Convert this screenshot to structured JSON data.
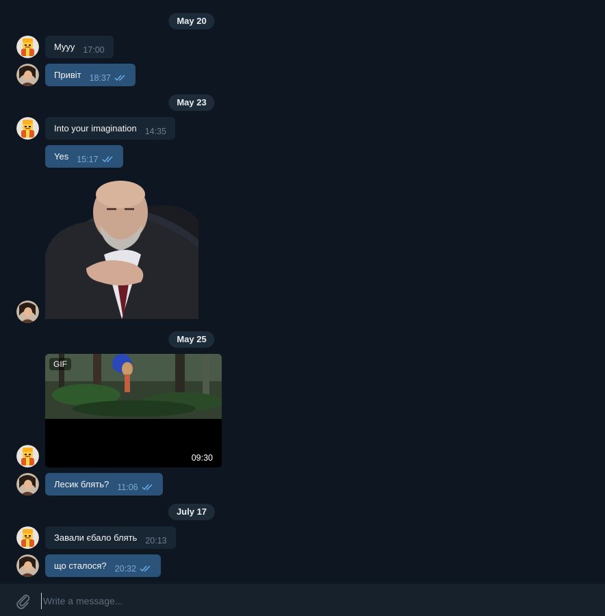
{
  "messages": [
    {
      "type": "date",
      "label": "May 20"
    },
    {
      "type": "text",
      "direction": "in",
      "text": "Myyy",
      "time": "17:00"
    },
    {
      "type": "text",
      "direction": "out",
      "text": "Привіт",
      "time": "18:37"
    },
    {
      "type": "date",
      "label": "May 23"
    },
    {
      "type": "text",
      "direction": "in",
      "text": "Into your imagination",
      "time": "14:35"
    },
    {
      "type": "text",
      "direction": "out",
      "text": "Yes",
      "time": "15:17"
    },
    {
      "type": "sticker",
      "direction": "out"
    },
    {
      "type": "date",
      "label": "May 25"
    },
    {
      "type": "gif",
      "direction": "in",
      "badge": "GIF",
      "duration": "09:30"
    },
    {
      "type": "text",
      "direction": "out",
      "text": "Лесик блять?",
      "time": "11:06"
    },
    {
      "type": "date",
      "label": "July 17"
    },
    {
      "type": "text",
      "direction": "in",
      "text": "Завали єбало блять",
      "time": "20:13"
    },
    {
      "type": "text",
      "direction": "out",
      "text": "що сталося?",
      "time": "20:32"
    }
  ],
  "composer": {
    "placeholder": "Write a message...",
    "attach_icon": "paperclip-icon"
  },
  "colors": {
    "background": "#0e1621",
    "incoming_bubble": "#182533",
    "outgoing_bubble": "#2b5278",
    "date_pill": "#1e2c3a",
    "read_ticks": "#6ab2f2"
  }
}
